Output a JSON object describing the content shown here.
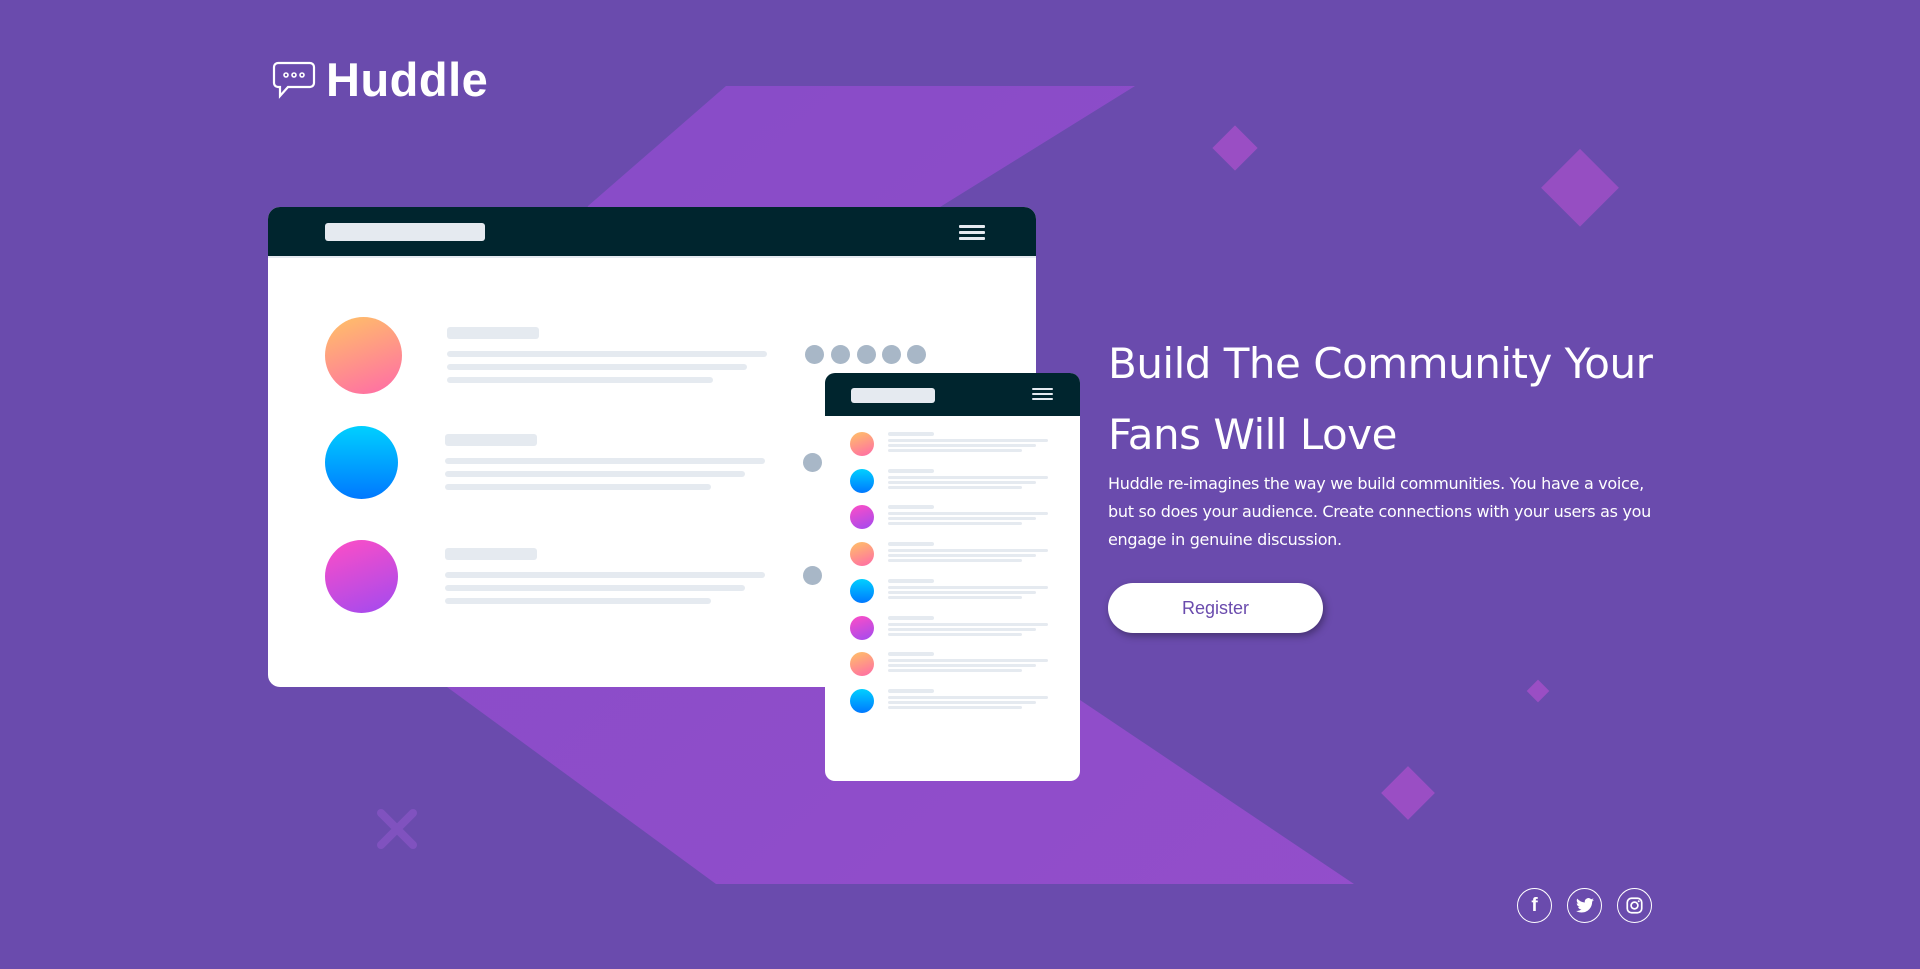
{
  "logo": {
    "text": "Huddle"
  },
  "hero": {
    "heading": "Build The Community Your Fans Will Love",
    "description": "Huddle re-imagines the way we build communities. You have a voice, but so does your audience. Create connections with your users as you engage in genuine discussion.",
    "register_label": "Register"
  },
  "social": [
    {
      "icon": "facebook-icon"
    },
    {
      "icon": "twitter-icon"
    },
    {
      "icon": "instagram-icon"
    }
  ],
  "colors": {
    "background": "#6a4bad",
    "accent_shape": "#9b4fd0",
    "mock_header": "#00252e"
  }
}
